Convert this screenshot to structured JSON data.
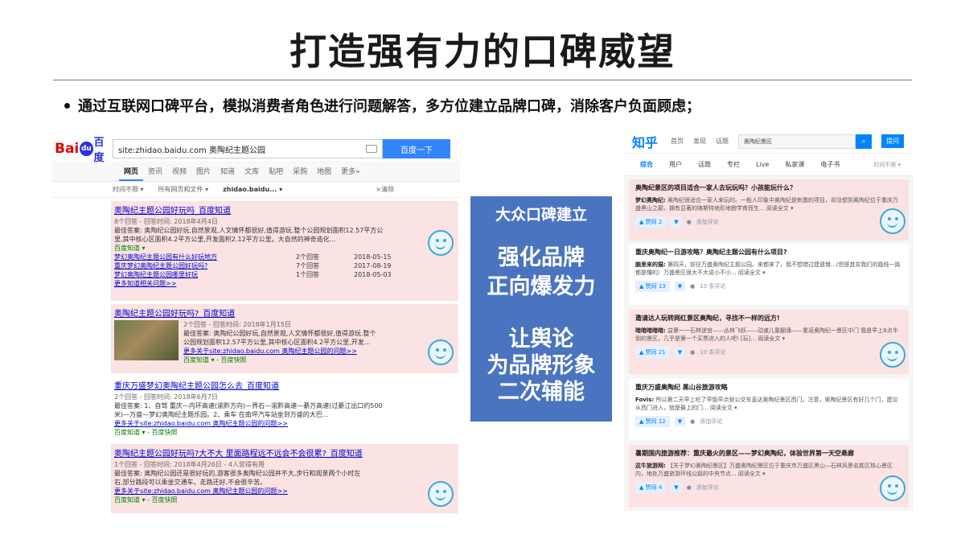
{
  "slide": {
    "title": "打造强有力的口碑威望",
    "bullet": "通过互联网口碑平台，模拟消费者角色进行问题解答，多方位建立品牌口碑，消除客户负面顾虑；"
  },
  "baidu": {
    "logo_bai": "Bai",
    "logo_du": "du",
    "logo_cn": "百度",
    "search_value": "site:zhidao.baidu.com 奥陶纪主题公园",
    "search_button": "百度一下",
    "nav": [
      "网页",
      "资讯",
      "视频",
      "图片",
      "知道",
      "文库",
      "贴吧",
      "采购",
      "地图",
      "更多»"
    ],
    "filters": [
      "时间不限 ▾",
      "所有网页和文件 ▾",
      "zhidao.baidu... ▾",
      "×清除"
    ],
    "results": [
      {
        "title": "奥陶纪主题公园好玩吗_百度知道",
        "meta": "8个回答 - 回答时间: 2018年4月4日",
        "body1": "最佳答案: 奥陶纪公园好玩,自然景观,人文情怀都很好,值得游玩.整个公园规划面积12.57平方公",
        "body2": "里,其中核心区面积4.2平方公里,开发面积2.12平方公里。大自然的神奇造化...",
        "source": "百度知道 ▾",
        "subs": [
          {
            "t": "梦幻奥陶纪主题公园有什么好玩地方",
            "a": "2个回答",
            "d": "2018-05-15"
          },
          {
            "t": "重庆梦幻奥陶纪主题公园好玩吗?",
            "a": "7个回答",
            "d": "2017-08-19"
          },
          {
            "t": "梦幻奥陶纪主题公园哪里好玩",
            "a": "1个回答",
            "d": "2018-05-03"
          }
        ],
        "more": "更多知道相关问题>>"
      },
      {
        "title": "奥陶纪主题公园好玩吗?_百度知道",
        "meta": "2个回答 - 回答时间: 2018年1月15日",
        "body1": "最佳答案: 奥陶纪公园好玩,自然景观,人文情怀都很好,值得游玩.整个",
        "body2": "公园规划面积12.57平方公里,其中核心区面积4.2平方公里,开发...",
        "more": "更多关于site:zhidao.baidu.com 奥陶纪主题公园的问题>>",
        "source": "百度知道 ▾ - 百度快照"
      },
      {
        "title": "重庆万盛梦幻奥陶纪主题公园怎么去_百度知道",
        "meta": "2个回答 - 回答时间: 2018年6月7日",
        "body1": "最佳答案: 1、自驾 重庆—内环高速(渝黔方向)—界石—渝黔高速—綦万高速(过綦江出口约500",
        "body2": "米)—万盛—梦幻奥陶纪主题乐园。2、乘车 在南坪汽车站坐到万盛的大巴...",
        "more": "更多关于site:zhidao.baidu.com 奥陶纪主题公园的问题>>",
        "source": "百度知道 ▾ - 百度快照"
      },
      {
        "title": "奥陶纪主题公园好玩吗?大不大 里面路程远不远会不会很累?_百度知道",
        "meta": "1个回答 - 回答时间: 2018年4月26日 - 4人觉得有用",
        "body1": "最佳答案: 奥陶纪公园还是很好玩的,游客很多奥陶纪公园并不大,步行和观景两个小时左",
        "body2": "右,部分路段可以乘坐交通车。走路还好,不会很辛苦。",
        "more": "更多关于site:zhidao.baidu.com 奥陶纪主题公园的问题>>",
        "source": "百度知道 ▾ - 百度快照"
      }
    ]
  },
  "middle": {
    "heading": "大众口碑建立",
    "block1_line1": "强化品牌",
    "block1_line2": "正向爆发力",
    "block2_line1": "让舆论",
    "block2_line2": "为品牌形象",
    "block2_line3": "二次辅能"
  },
  "zhihu": {
    "logo": "知乎",
    "nav": [
      "首页",
      "发现",
      "话题"
    ],
    "search_value": "奥陶纪景区",
    "ask_button": "提问",
    "tabs": [
      "综合",
      "用户",
      "话题",
      "专栏",
      "Live",
      "私家课",
      "电子书"
    ],
    "time_filter": "时间不限 ▾",
    "cards": [
      {
        "title": "奥陶纪景区的项目适合一家人去玩玩吗？小孩能玩什么？",
        "author": "梦幻奥陶纪:",
        "body": "奥陶纪很适合一家人来玩的。一般人印象中奥陶纪是刺激的项目，却没想到奥陶纪位于重庆万盛黑山之巅，拥有显著的喀斯特地形地貌学育而生... 阅读全文 ▾",
        "votes": "▲ 赞同 2",
        "comments": "添加评论"
      },
      {
        "title": "重庆奥陶纪一日游攻略？奥陶纪主题公园有什么项目?",
        "author": "脑里来的猫:",
        "body": "第四天，前往万盛奥陶纪主题公园。来都来了，我不想错过建遗憾...(但是其实我们的路线一路都是懵的）万盛景区很大不大说小不小... 阅读全文 ▾",
        "votes": "▲ 赞同 13",
        "comments": "10 条评论"
      },
      {
        "title": "邀请达人玩转网红景区奥陶纪，寻找不一样的远方!",
        "author": "暗暗暗暗暗:",
        "body": "益第一一石林迷宫——丛林飞跃——动速儿童翻涌——重返奥陶纪一景区中门 我是早上8点半到的景区，几乎是第一个买票进入的人吧! [玩]... 阅读全文 ▾",
        "votes": "▲ 赞同 21",
        "comments": "10 条评论"
      },
      {
        "title": "重庆万盛奥陶纪 黑山谷旅游攻略",
        "author": "Fovis:",
        "body": "所以第二天早上吃了早饭早点就公交车直达奥陶纪景区西门。注意，奥陶纪景区有好几个门，建议从西门进入，就是最上的门... 阅读全文 ▾",
        "votes": "▲ 赞同 12",
        "comments": "添加评论"
      },
      {
        "title": "暑期国内旅游推荐：重庆最火的景区——梦幻奥陶纪，体验世界第一天空悬廊",
        "author": "这牛旅游网:",
        "body": "【关于梦幻奥陶纪景区】万盛奥陶纪景区位于重庆市万盛区黑山—石林风景名胜区核心景区内，地处万盛旅游环线公路的中央节点... 阅读全文 ▾",
        "votes": "▲ 赞同 4",
        "comments": "添加评论"
      }
    ]
  },
  "colors": {
    "baidu_red": "#e10602",
    "baidu_blue": "#2932e1",
    "baidu_button": "#3385ff",
    "highlight_pink": "#fbe3e3",
    "middle_box": "#4a74c0",
    "zhihu_blue": "#0084ff",
    "smile": "#3fa7d6"
  }
}
